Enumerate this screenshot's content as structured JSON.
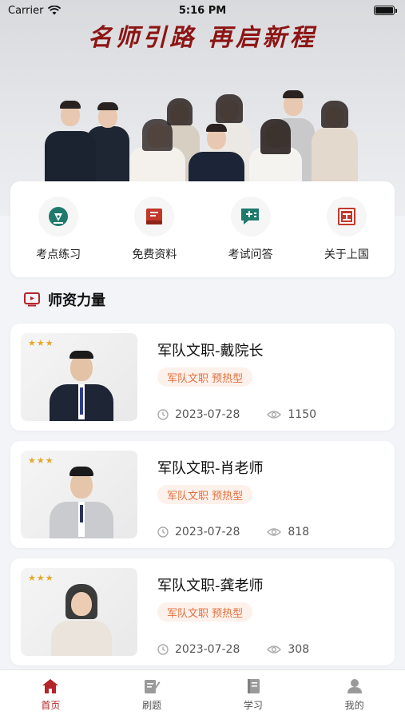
{
  "status_bar": {
    "carrier": "Carrier",
    "time": "5:16 PM"
  },
  "banner": {
    "title": "名师引路  再启新程"
  },
  "quick_menu": [
    {
      "label": "考点练习",
      "icon": "pen-nib-icon"
    },
    {
      "label": "免费资料",
      "icon": "book-icon"
    },
    {
      "label": "考试问答",
      "icon": "chat-plus-icon"
    },
    {
      "label": "关于上国",
      "icon": "info-grid-icon"
    }
  ],
  "section": {
    "title": "师资力量",
    "icon": "tv-play-icon"
  },
  "teachers": [
    {
      "name": "军队文职-戴院长",
      "tag": "军队文职 预热型",
      "date": "2023-07-28",
      "views": "1150",
      "stars": "★★★"
    },
    {
      "name": "军队文职-肖老师",
      "tag": "军队文职 预热型",
      "date": "2023-07-28",
      "views": "818",
      "stars": "★★★"
    },
    {
      "name": "军队文职-龚老师",
      "tag": "军队文职 预热型",
      "date": "2023-07-28",
      "views": "308",
      "stars": "★★★"
    }
  ],
  "tab_bar": [
    {
      "label": "首页",
      "icon": "home-icon",
      "active": true
    },
    {
      "label": "刷题",
      "icon": "edit-doc-icon",
      "active": false
    },
    {
      "label": "学习",
      "icon": "notebook-icon",
      "active": false
    },
    {
      "label": "我的",
      "icon": "user-icon",
      "active": false
    }
  ],
  "colors": {
    "brand": "#b4252a",
    "accent": "#e2703c",
    "star": "#e5a829"
  }
}
